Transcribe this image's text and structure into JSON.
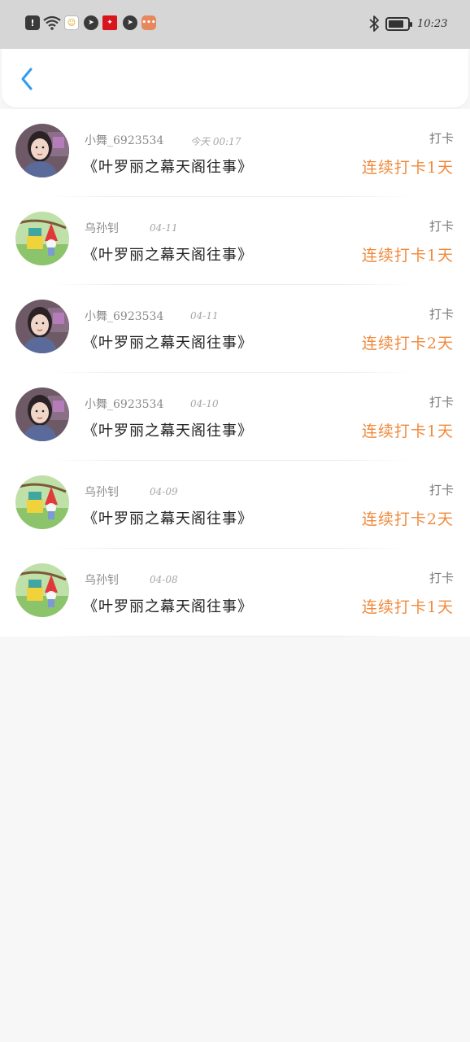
{
  "status_bar": {
    "time": "10:23",
    "icons": [
      "alert-icon",
      "wifi-icon",
      "app-icon",
      "app-icon",
      "app-icon",
      "app-icon",
      "chat-icon",
      "bluetooth-icon",
      "battery-icon"
    ]
  },
  "header": {
    "back_icon": "chevron-left-icon",
    "accent_color": "#2f9cf0"
  },
  "list": {
    "accent_color": "#f08a3c",
    "items": [
      {
        "name": "小舞_6923534",
        "time": "今天 00:17",
        "title": "《叶罗丽之幕天阁往事》",
        "tag": "打卡",
        "streak": "连续打卡1天",
        "avatar": "girl"
      },
      {
        "name": "乌孙钊",
        "time": "04-11",
        "title": "《叶罗丽之幕天阁往事》",
        "tag": "打卡",
        "streak": "连续打卡1天",
        "avatar": "toy"
      },
      {
        "name": "小舞_6923534",
        "time": "04-11",
        "title": "《叶罗丽之幕天阁往事》",
        "tag": "打卡",
        "streak": "连续打卡2天",
        "avatar": "girl"
      },
      {
        "name": "小舞_6923534",
        "time": "04-10",
        "title": "《叶罗丽之幕天阁往事》",
        "tag": "打卡",
        "streak": "连续打卡1天",
        "avatar": "girl"
      },
      {
        "name": "乌孙钊",
        "time": "04-09",
        "title": "《叶罗丽之幕天阁往事》",
        "tag": "打卡",
        "streak": "连续打卡2天",
        "avatar": "toy"
      },
      {
        "name": "乌孙钊",
        "time": "04-08",
        "title": "《叶罗丽之幕天阁往事》",
        "tag": "打卡",
        "streak": "连续打卡1天",
        "avatar": "toy"
      }
    ]
  }
}
